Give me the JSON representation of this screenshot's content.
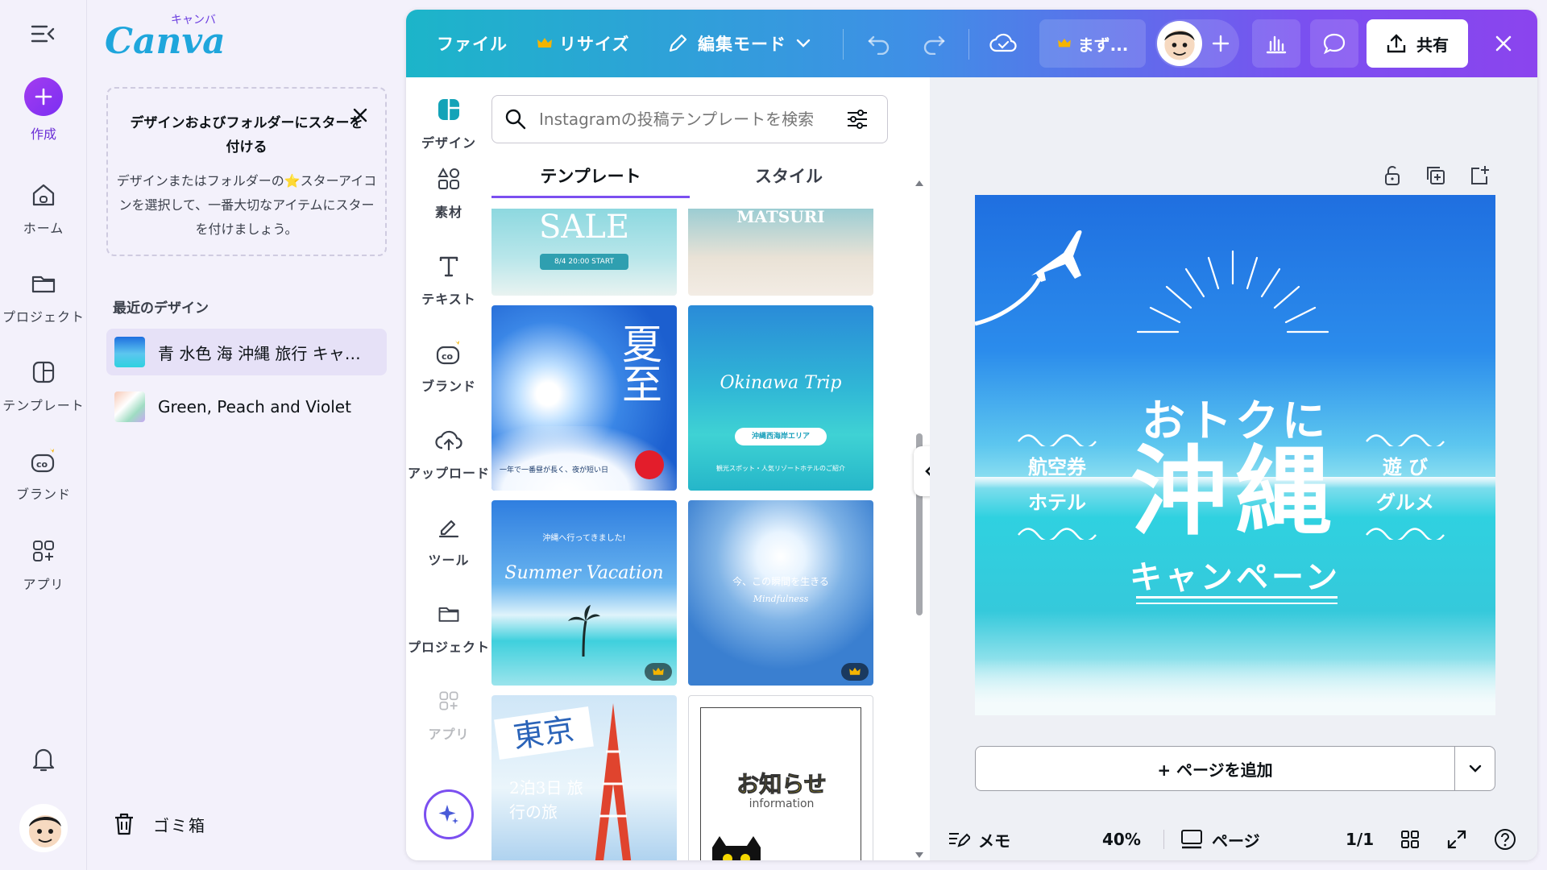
{
  "rail": {
    "create_label": "作成",
    "items": [
      {
        "label": "ホーム",
        "icon": "home-icon"
      },
      {
        "label": "プロジェクト",
        "icon": "folder-icon"
      },
      {
        "label": "テンプレート",
        "icon": "template-icon"
      },
      {
        "label": "ブランド",
        "icon": "brand-icon"
      },
      {
        "label": "アプリ",
        "icon": "apps-icon"
      }
    ]
  },
  "home": {
    "logo": "Canva",
    "logo_kana": "キャンバ",
    "star_tip": {
      "title": "デザインおよびフォルダーにスターを付ける",
      "body": "デザインまたはフォルダーの⭐スターアイコンを選択して、一番大切なアイテムにスターを付けましょう。"
    },
    "recent_heading": "最近のデザイン",
    "recent": [
      {
        "name": "青 水色 海 沖縄 旅行 キャンペーン"
      },
      {
        "name": "Green, Peach and Violet"
      }
    ],
    "trash_label": "ゴミ箱"
  },
  "topbar": {
    "file": "ファイル",
    "resize": "リサイズ",
    "edit_mode": "編集モード",
    "pill": "まず...",
    "share": "共有"
  },
  "tools": [
    {
      "label": "デザイン",
      "icon": "design-icon"
    },
    {
      "label": "素材",
      "icon": "elements-icon"
    },
    {
      "label": "テキスト",
      "icon": "text-icon"
    },
    {
      "label": "ブランド",
      "icon": "brand-icon"
    },
    {
      "label": "アップロード",
      "icon": "upload-icon"
    },
    {
      "label": "ツール",
      "icon": "tools-icon"
    },
    {
      "label": "プロジェクト",
      "icon": "folder-icon"
    },
    {
      "label": "アプリ",
      "icon": "apps-icon"
    }
  ],
  "templates": {
    "search_placeholder": "Instagramの投稿テンプレートを検索",
    "tab_templates": "テンプレート",
    "tab_styles": "スタイル",
    "cards": [
      {
        "title": "SALE",
        "sub": "8/4 20:00 START"
      },
      {
        "title": "MATSURI"
      },
      {
        "title": "夏至",
        "sub": "一年で一番昼が長く、夜が短い日"
      },
      {
        "title": "Okinawa Trip",
        "sub": "観光スポット・人気リゾートホテルのご紹介",
        "ribbon": "沖縄西海岸エリア"
      },
      {
        "title": "Summer Vacation",
        "sub": "沖縄へ行ってきました!"
      },
      {
        "title": "今、この瞬間を生きる",
        "sub": "Mindfulness"
      },
      {
        "title": "東京",
        "sub": "2泊3日 旅行の旅"
      },
      {
        "title": "お知らせ",
        "sub": "information"
      }
    ]
  },
  "design": {
    "headline_a": "おトクに",
    "headline_main": "沖縄",
    "headline_sub": "キャンペーン",
    "left_1": "航空券",
    "left_2": "ホテル",
    "right_1": "遊 び",
    "right_2": "グルメ"
  },
  "canvas": {
    "add_page": "+ ページを追加"
  },
  "bottombar": {
    "notes": "メモ",
    "zoom": "40%",
    "pages": "ページ",
    "page_count": "1/1"
  },
  "colors": {
    "brand_purple": "#7b4ff0",
    "topbar_start": "#1cb5c9",
    "topbar_end": "#8b44ee",
    "accent_yellow": "#ffe14a"
  }
}
